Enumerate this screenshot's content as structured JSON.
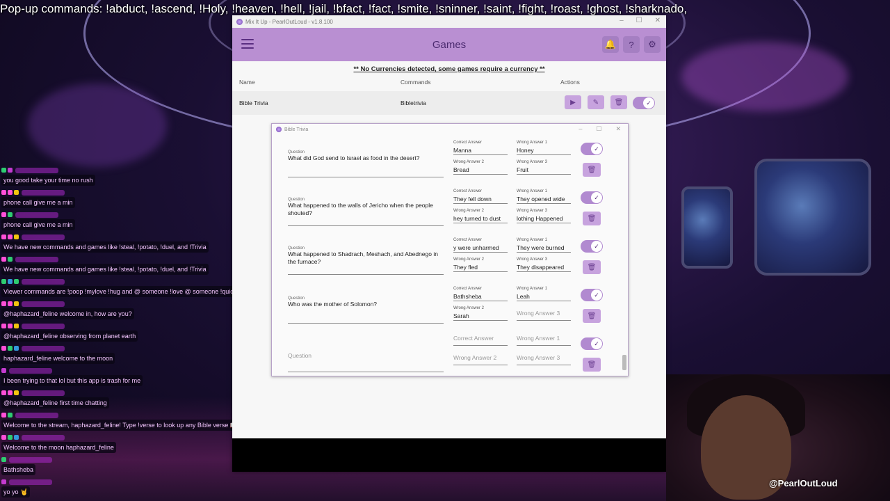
{
  "ticker": "Pop-up commands: !abduct, !ascend, !Holy, !heaven, !hell,  !jail, !bfact, !fact, !smite, !sninner, !saint, !fight, !roast, !ghost, !sharknado,",
  "chat": [
    {
      "text": "you good take your time no rush",
      "badges": [
        "#2ecc71",
        "#c43bd0"
      ]
    },
    {
      "text": "phone call give me a min",
      "badges": [
        "#ff4fd8",
        "#ff4fd8",
        "#f1c40f"
      ]
    },
    {
      "text": "phone call give me a min",
      "badges": [
        "#ff4fd8",
        "#2ecc71"
      ]
    },
    {
      "text": "We have new commands and games like !steal, !potato, !duel, and !Trivia",
      "badges": [
        "#ff4fd8",
        "#ff4fd8",
        "#f1c40f"
      ]
    },
    {
      "text": "We have new commands and games like !steal, !potato, !duel, and !Trivia",
      "badges": [
        "#ff4fd8",
        "#2ecc71"
      ]
    },
    {
      "text": "Viewer commands are !poop !mylove !hug and @ someone !love @ someone !quick !flute !lily !eyes !punch and @ someone",
      "badges": [
        "#2ecc71",
        "#3498db",
        "#2ecc71"
      ]
    },
    {
      "text": "@haphazard_feline welcome in, how are you?",
      "badges": [
        "#ff4fd8",
        "#ff4fd8",
        "#f1c40f"
      ]
    },
    {
      "text": "@haphazard_feline observing from planet earth",
      "badges": [
        "#ff4fd8",
        "#ff4fd8",
        "#f1c40f"
      ]
    },
    {
      "text": "haphazard_feline welcome to the moon",
      "badges": [
        "#ff4fd8",
        "#2ecc71",
        "#3498db"
      ]
    },
    {
      "text": "I been trying to that lol but this app is trash for me",
      "badges": [
        "#c43bd0"
      ]
    },
    {
      "text": "@haphazard_feline first time chatting",
      "badges": [
        "#ff4fd8",
        "#ff4fd8",
        "#f1c40f"
      ]
    },
    {
      "text": "Welcome to the stream, haphazard_feline! Type !verse to look up any Bible verse 📖",
      "badges": [
        "#ff4fd8",
        "#2ecc71"
      ]
    },
    {
      "text": "Welcome to the moon haphazard_feline",
      "badges": [
        "#ff4fd8",
        "#2ecc71",
        "#3498db"
      ]
    },
    {
      "text": "Bathsheba",
      "badges": [
        "#2ecc71"
      ]
    },
    {
      "text": "yo yo 🤘",
      "badges": [
        "#c43bd0"
      ]
    }
  ],
  "app": {
    "window_title": "Mix It Up - PearlOutLoud - v1.8.100",
    "header_title": "Games",
    "notice": "** No Currencies detected, some games require a currency **",
    "columns": {
      "name": "Name",
      "commands": "Commands",
      "actions": "Actions"
    },
    "game": {
      "name": "Bible Trivia",
      "command": "Bibletrivia",
      "enabled": true
    }
  },
  "dialog": {
    "title": "Bible Trivia",
    "questions": [
      {
        "question_label": "Question",
        "question": "What did God send to Israel as food in the desert?",
        "correct_label": "Correct Answer",
        "correct": "Manna",
        "w1_label": "Wrong Answer 1",
        "w1": "Honey",
        "w2_label": "Wrong Answer 2",
        "w2": "Bread",
        "w3_label": "Wrong Answer 3",
        "w3": "Fruit"
      },
      {
        "question_label": "Question",
        "question": "What happened to the walls of Jericho when the people shouted?",
        "correct_label": "Correct Answer",
        "correct": "They fell down",
        "w1_label": "Wrong Answer 1",
        "w1": "They opened wide",
        "w2_label": "Wrong Answer 2",
        "w2": "hey turned to dust",
        "w3_label": "Wrong Answer 3",
        "w3": "lothing Happened"
      },
      {
        "question_label": "Question",
        "question": "What happened to Shadrach, Meshach, and Abednego in the furnace?",
        "correct_label": "Correct Answer",
        "correct": "y were unharmed",
        "w1_label": "Wrong Answer 1",
        "w1": "They were burned",
        "w2_label": "Wrong Answer 2",
        "w2": "They fled",
        "w3_label": "Wrong Answer 3",
        "w3": "They disappeared"
      },
      {
        "question_label": "Question",
        "question": "Who was the mother of Solomon?",
        "correct_label": "Correct Answer",
        "correct": "Bathsheba",
        "w1_label": "Wrong Answer 1",
        "w1": "Leah",
        "w2_label": "Wrong Answer 2",
        "w2": "Sarah",
        "w3_placeholder": "Wrong Answer 3"
      }
    ],
    "new_entry": {
      "question_placeholder": "Question",
      "correct_placeholder": "Correct Answer",
      "w1_placeholder": "Wrong Answer 1",
      "w2_placeholder": "Wrong Answer 2",
      "w3_placeholder": "Wrong Answer 3"
    }
  },
  "watermark": "@PearlOutLoud",
  "icons": {
    "menu": "hamburger-icon",
    "bell": "bell-icon",
    "help": "help-icon",
    "settings": "gear-icon",
    "play": "play-icon",
    "edit": "edit-icon",
    "delete": "trash-icon",
    "toggle": "check-icon"
  },
  "colors": {
    "accent": "#b98fd2",
    "button": "#c7a3de",
    "toggle": "#b18ad0",
    "text": "#4b2a6f"
  }
}
